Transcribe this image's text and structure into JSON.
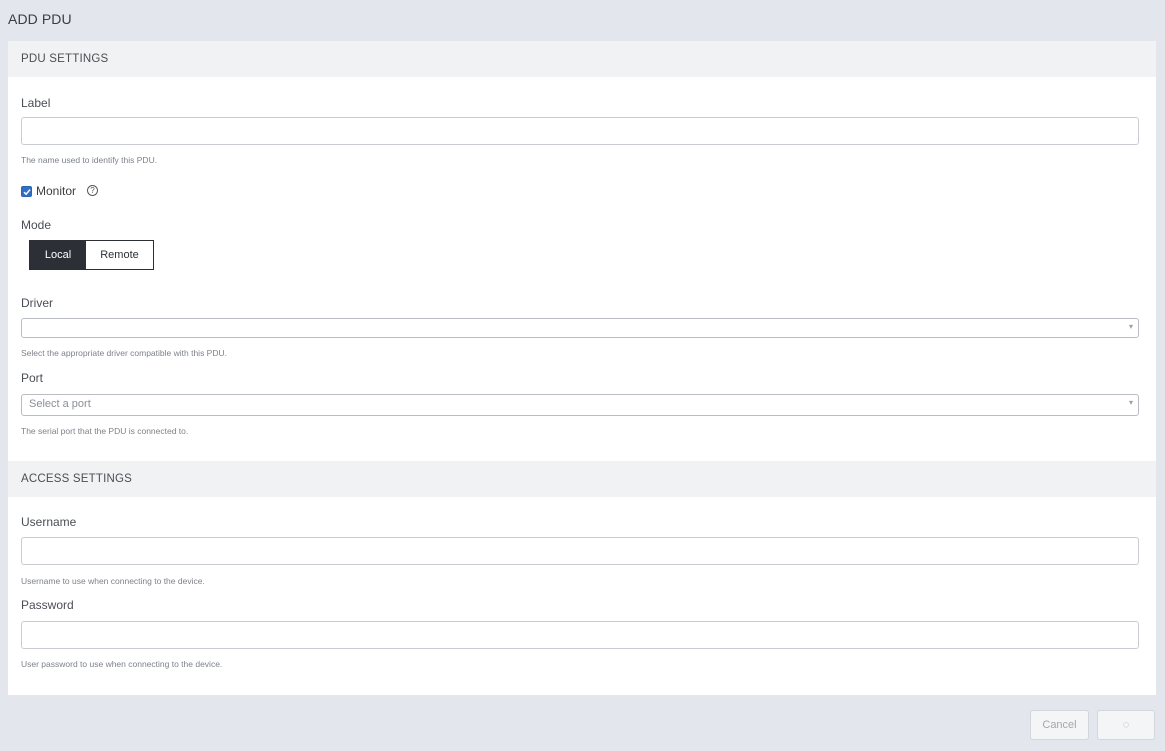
{
  "page": {
    "title": "ADD PDU"
  },
  "pdu_settings": {
    "header": "PDU SETTINGS",
    "label": {
      "label": "Label",
      "value": "",
      "help": "The name used to identify this PDU."
    },
    "monitor": {
      "label": "Monitor",
      "checked": true,
      "help_icon": "?"
    },
    "mode": {
      "label": "Mode",
      "options": [
        "Local",
        "Remote"
      ],
      "selected": "Local"
    },
    "driver": {
      "label": "Driver",
      "value": "",
      "caret": "▾",
      "help": "Select the appropriate driver compatible with this PDU."
    },
    "port": {
      "label": "Port",
      "placeholder": "Select a port",
      "caret": "▾",
      "help": "The serial port that the PDU is connected to."
    }
  },
  "access_settings": {
    "header": "ACCESS SETTINGS",
    "username": {
      "label": "Username",
      "value": "",
      "help": "Username to use when connecting to the device."
    },
    "password": {
      "label": "Password",
      "value": "",
      "help": "User password to use when connecting to the device."
    }
  },
  "footer": {
    "cancel_label": "Cancel",
    "save_label": "◌"
  },
  "colors": {
    "checkbox": "#2f6fc4",
    "active_mode": "#2c3036",
    "background": "#e3e6ec"
  }
}
